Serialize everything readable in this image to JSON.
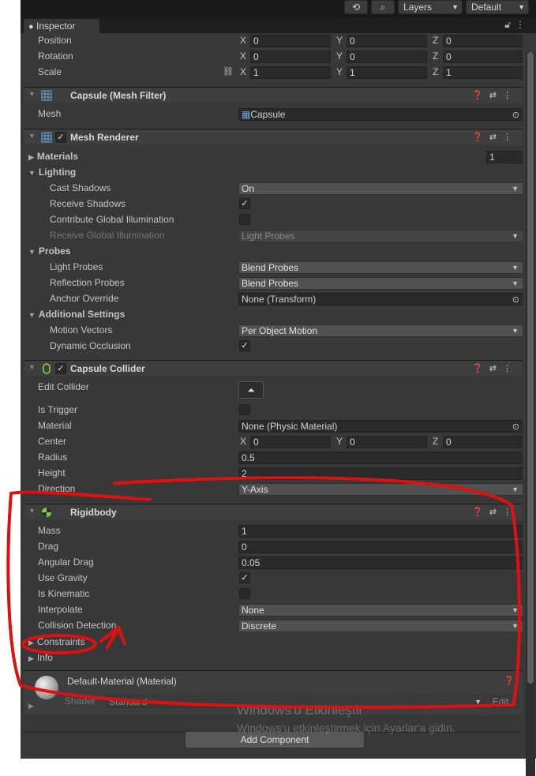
{
  "toolbar": {
    "layers": "Layers",
    "layout": "Default"
  },
  "inspector": {
    "tab": "Inspector"
  },
  "transform": {
    "position": {
      "label": "Position",
      "x": "0",
      "y": "0",
      "z": "0"
    },
    "rotation": {
      "label": "Rotation",
      "x": "0",
      "y": "0",
      "z": "0"
    },
    "scale": {
      "label": "Scale",
      "x": "1",
      "y": "1",
      "z": "1"
    },
    "axes": {
      "x": "X",
      "y": "Y",
      "z": "Z"
    }
  },
  "mesh_filter": {
    "title": "Capsule (Mesh Filter)",
    "mesh_label": "Mesh",
    "mesh_value": "Capsule"
  },
  "mesh_renderer": {
    "title": "Mesh Renderer",
    "materials_label": "Materials",
    "materials_count": "1",
    "lighting": "Lighting",
    "cast_shadows_label": "Cast Shadows",
    "cast_shadows_value": "On",
    "receive_shadows_label": "Receive Shadows",
    "contribute_gi_label": "Contribute Global Illumination",
    "receive_gi_label": "Receive Global Illumination",
    "receive_gi_value": "Light Probes",
    "probes": "Probes",
    "light_probes_label": "Light Probes",
    "light_probes_value": "Blend Probes",
    "reflection_probes_label": "Reflection Probes",
    "reflection_probes_value": "Blend Probes",
    "anchor_override_label": "Anchor Override",
    "anchor_override_value": "None (Transform)",
    "additional": "Additional Settings",
    "motion_vectors_label": "Motion Vectors",
    "motion_vectors_value": "Per Object Motion",
    "dynamic_occlusion_label": "Dynamic Occlusion"
  },
  "capsule_collider": {
    "title": "Capsule Collider",
    "edit_collider_label": "Edit Collider",
    "is_trigger_label": "Is Trigger",
    "material_label": "Material",
    "material_value": "None (Physic Material)",
    "center_label": "Center",
    "center_x": "0",
    "center_y": "0",
    "center_z": "0",
    "radius_label": "Radius",
    "radius_value": "0.5",
    "height_label": "Height",
    "height_value": "2",
    "direction_label": "Direction",
    "direction_value": "Y-Axis"
  },
  "rigidbody": {
    "title": "Rigidbody",
    "mass_label": "Mass",
    "mass_value": "1",
    "drag_label": "Drag",
    "drag_value": "0",
    "angular_drag_label": "Angular Drag",
    "angular_drag_value": "0.05",
    "use_gravity_label": "Use Gravity",
    "is_kinematic_label": "Is Kinematic",
    "interpolate_label": "Interpolate",
    "interpolate_value": "None",
    "collision_label": "Collision Detection",
    "collision_value": "Discrete",
    "constraints_label": "Constraints",
    "info_label": "Info"
  },
  "material": {
    "title": "Default-Material (Material)",
    "shader_label": "Shader",
    "shader_value": "Standard",
    "edit_label": "Edit..."
  },
  "add_component": "Add Component",
  "watermark": {
    "line1": "Windows'u Etkinleştir",
    "line2": "Windows'u etkinleştirmek için Ayarlar'a gidin."
  },
  "annotation_color": "#e01010"
}
